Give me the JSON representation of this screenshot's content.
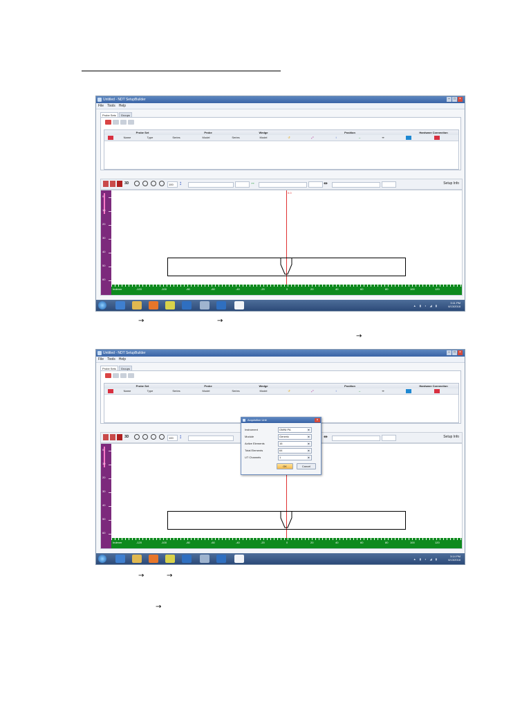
{
  "doc": {
    "arrow": "→"
  },
  "screenshots": [
    {
      "app_title": "Untitled - NDT SetupBuilder",
      "menu": [
        "File",
        "Tools",
        "Help"
      ],
      "tabs": [
        "Probe Sets",
        "Groups"
      ],
      "grid_headers": [
        "Probe Set",
        "Probe",
        "Wedge",
        "Position",
        "Hardware Connection"
      ],
      "grid_subheaders": [
        "Name",
        "Type",
        "Series",
        "Model",
        "Series",
        "Model"
      ],
      "toolbar_3d": "3D",
      "zoom_value": "100",
      "setup_info": "Setup Info",
      "beam_label": "0.0",
      "vruler_labels": [
        "0",
        "10",
        "20",
        "30",
        "40",
        "50",
        "60"
      ],
      "hruler_labels": [
        "Indexer",
        "-120",
        "-100",
        "-80",
        "-60",
        "-40",
        "-20",
        "0",
        "20",
        "40",
        "60",
        "80",
        "100",
        "120"
      ],
      "clock_time": "3:11 PM",
      "clock_date": "6/13/2018"
    },
    {
      "app_title": "Untitled - NDT SetupBuilder",
      "menu": [
        "File",
        "Tools",
        "Help"
      ],
      "tabs": [
        "Probe Sets",
        "Groups"
      ],
      "grid_headers": [
        "Probe Set",
        "Probe",
        "Wedge",
        "Position",
        "Hardware Connection"
      ],
      "grid_subheaders": [
        "Name",
        "Type",
        "Series",
        "Model",
        "Series",
        "Model"
      ],
      "toolbar_3d": "3D",
      "zoom_value": "100",
      "setup_info": "Setup Info",
      "vruler_labels": [
        "0",
        "10",
        "20",
        "30",
        "40",
        "50",
        "60"
      ],
      "hruler_labels": [
        "Indexer",
        "-120",
        "-100",
        "-80",
        "-60",
        "-40",
        "-20",
        "0",
        "20",
        "40",
        "60",
        "80",
        "100",
        "120"
      ],
      "clock_time": "3:14 PM",
      "clock_date": "6/13/2018",
      "dialog": {
        "title": "Acquisition Unit",
        "fields": [
          {
            "label": "Instrument",
            "value": "OMNI PA"
          },
          {
            "label": "Module",
            "value": "Generic"
          },
          {
            "label": "Active Elements",
            "value": "16"
          },
          {
            "label": "Total Elements",
            "value": "64"
          },
          {
            "label": "UT Channels",
            "value": "1"
          }
        ],
        "ok": "OK",
        "cancel": "Cancel"
      }
    }
  ]
}
